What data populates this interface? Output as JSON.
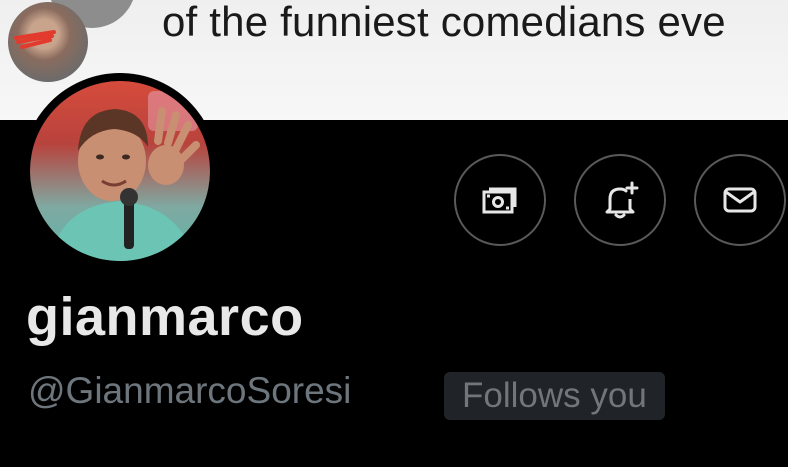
{
  "banner": {
    "tweet_text": "of the funniest comedians eve"
  },
  "profile": {
    "display_name": "gianmarco",
    "handle": "@GianmarcoSoresi",
    "follows_you_badge": "Follows you"
  },
  "actions": [
    {
      "icon": "tip-money-icon"
    },
    {
      "icon": "bell-plus-icon"
    },
    {
      "icon": "mail-icon"
    }
  ],
  "colors": {
    "background": "#000000",
    "display_name": "#e8e8e8",
    "handle": "#6e767d",
    "badge_bg": "#202327",
    "button_border": "#5a5a5a"
  }
}
